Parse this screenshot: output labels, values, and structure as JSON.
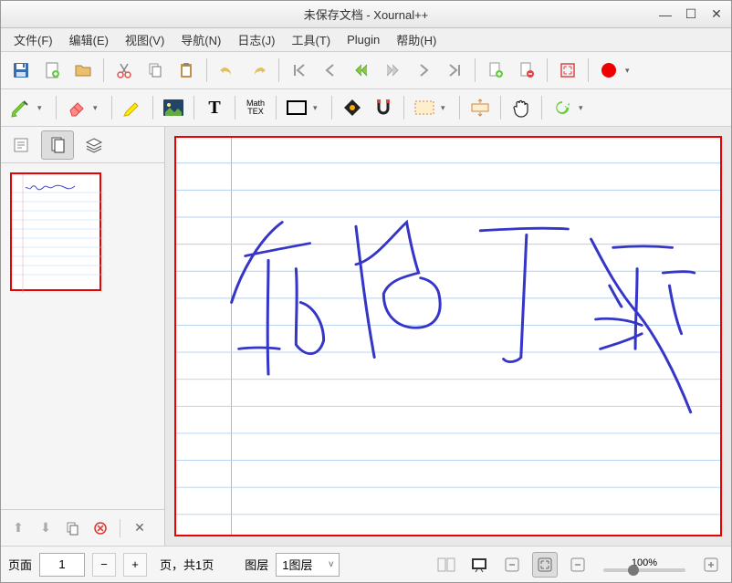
{
  "window": {
    "title": "未保存文档 - Xournal++"
  },
  "menu": {
    "file": "文件(F)",
    "edit": "编辑(E)",
    "view": "视图(V)",
    "nav": "导航(N)",
    "log": "日志(J)",
    "tools": "工具(T)",
    "plugin": "Plugin",
    "help": "帮助(H)"
  },
  "mathtex": {
    "line1": "Math",
    "line2": "TEX"
  },
  "status": {
    "page_label": "页面",
    "page_value": "1",
    "page_total": "页，共1页",
    "layer_label": "图层",
    "layer_value": "1图层",
    "zoom": "100%"
  }
}
